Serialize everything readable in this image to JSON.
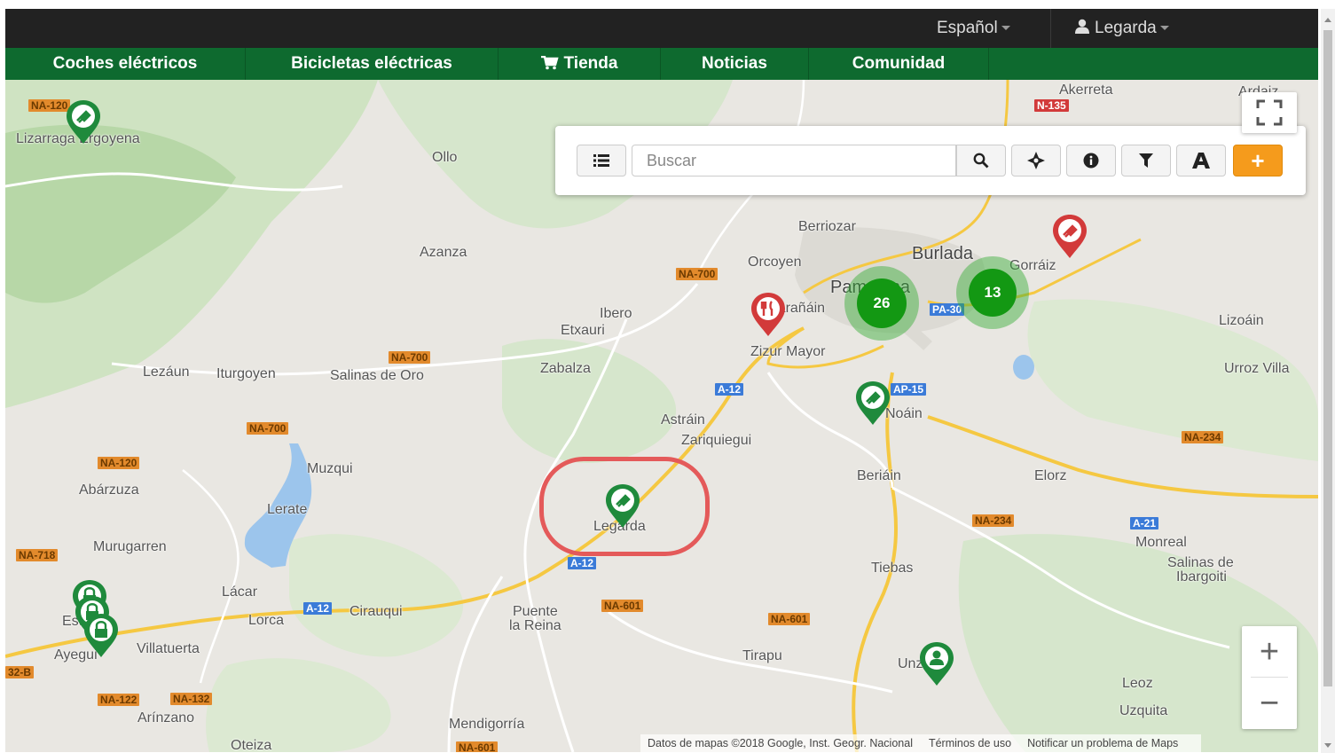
{
  "topbar": {
    "language_label": "Español",
    "user_label": "Legarda"
  },
  "navbar": {
    "items": [
      "Coches eléctricos",
      "Bicicletas eléctricas",
      "Tienda",
      "Noticias",
      "Comunidad"
    ]
  },
  "search": {
    "placeholder": "Buscar",
    "icons": [
      "list-icon",
      "search-icon",
      "locate-icon",
      "info-icon",
      "filter-icon",
      "text-icon",
      "plus-icon"
    ]
  },
  "map": {
    "places": {
      "akerreta": "Akerreta",
      "ardaiz": "Ardaiz",
      "lizarraga": "Lizarraga Ergoyena",
      "ollo": "Ollo",
      "berriozar": "Berriozar",
      "burlada": "Burlada",
      "orcoyen": "Orcoyen",
      "gorraiz": "Gorráiz",
      "azanza": "Azanza",
      "pamplona": "Pamplona",
      "barañain": "Barañáin",
      "lizoain": "Lizoáin",
      "ibero": "Ibero",
      "etxauri": "Etxauri",
      "zizur": "Zizur Mayor",
      "zabalza": "Zabalza",
      "urroz": "Urroz Villa",
      "lezaun": "Lezáun",
      "iturgoyen": "Iturgoyen",
      "salinas_oro": "Salinas de Oro",
      "noain": "Noáin",
      "astrain": "Astráin",
      "zariquiegui": "Zariquiegui",
      "muzqui": "Muzqui",
      "beriain": "Beriáin",
      "elorz": "Elorz",
      "abarzuza": "Abárzuza",
      "lerate": "Lerate",
      "legarda": "Legarda",
      "monreal": "Monreal",
      "murugarren": "Murugarren",
      "salinas_ib_1": "Salinas de",
      "salinas_ib_2": "Ibargoiti",
      "tiebas": "Tiebas",
      "lacar": "Lácar",
      "estella": "Estella",
      "lorca": "Lorca",
      "cirauqui": "Cirauqui",
      "puente_1": "Puente",
      "puente_2": "la Reina",
      "ayegui": "Ayegui",
      "villatuerta": "Villatuerta",
      "tirapu": "Tirapu",
      "unzue": "Unzué",
      "leoz": "Leoz",
      "uzquita": "Uzquita",
      "arinzano": "Arínzano",
      "mendigorria": "Mendigorría",
      "oteiza": "Oteiza"
    },
    "roads": {
      "na120a": "NA-120",
      "n135": "N-135",
      "na700a": "NA-700",
      "pa30": "PA-30",
      "na700b": "NA-700",
      "a12a": "A-12",
      "ap15": "AP-15",
      "na700c": "NA-700",
      "na234a": "NA-234",
      "na120b": "NA-120",
      "na234b": "NA-234",
      "a21": "A-21",
      "na718": "NA-718",
      "a12b": "A-12",
      "na601a": "NA-601",
      "a12c": "A-12",
      "na601b": "NA-601",
      "r32b": "32-B",
      "na122": "NA-122",
      "na132": "NA-132",
      "na601c": "NA-601"
    },
    "clusters": {
      "pamplona": "26",
      "burlada": "13"
    },
    "attribution": {
      "data": "Datos de mapas ©2018 Google, Inst. Geogr. Nacional",
      "terms": "Términos de uso",
      "report": "Notificar un problema de Maps"
    }
  },
  "colors": {
    "nav_green": "#0e6a2f",
    "marker_green": "#1f8a3c",
    "marker_red": "#d23a3a",
    "add_orange": "#f59b1c",
    "highlight_red": "#e45a5a"
  }
}
